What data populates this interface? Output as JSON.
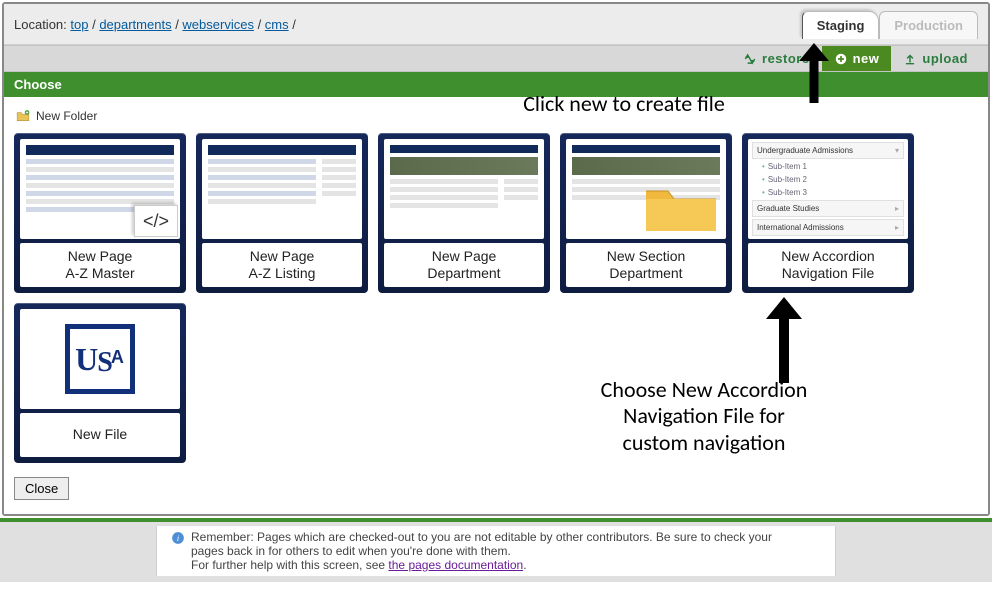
{
  "breadcrumb": {
    "label": "Location:",
    "items": [
      "top",
      "departments",
      "webservices",
      "cms"
    ]
  },
  "tabs": {
    "staging": "Staging",
    "production": "Production"
  },
  "actions": {
    "restore": "restore",
    "new": "new",
    "upload": "upload"
  },
  "choose_header": "Choose",
  "new_folder": "New Folder",
  "tiles": [
    {
      "line1": "New Page",
      "line2": "A-Z Master"
    },
    {
      "line1": "New Page",
      "line2": "A-Z Listing"
    },
    {
      "line1": "New Page",
      "line2": "Department"
    },
    {
      "line1": "New Section",
      "line2": "Department"
    },
    {
      "line1": "New Accordion",
      "line2": "Navigation File"
    },
    {
      "line1": "New File",
      "line2": ""
    }
  ],
  "accordion_preview": {
    "head1": "Undergraduate Admissions",
    "sub1": "Sub-Item 1",
    "sub2": "Sub-Item 2",
    "sub3": "Sub-Item 3",
    "head2": "Graduate Studies",
    "head3": "International Admissions"
  },
  "close": "Close",
  "annotations": {
    "top": "Click new to create file",
    "mid1": "Choose New Accordion",
    "mid2": "Navigation File for",
    "mid3": "custom navigation"
  },
  "footer": {
    "line1": "Remember: Pages which are checked-out to you are not editable by other contributors. Be sure to check your pages back in for others to edit when you're done with them.",
    "line2_pre": "For further help with this screen, see ",
    "link": "the pages documentation",
    "line2_post": "."
  }
}
